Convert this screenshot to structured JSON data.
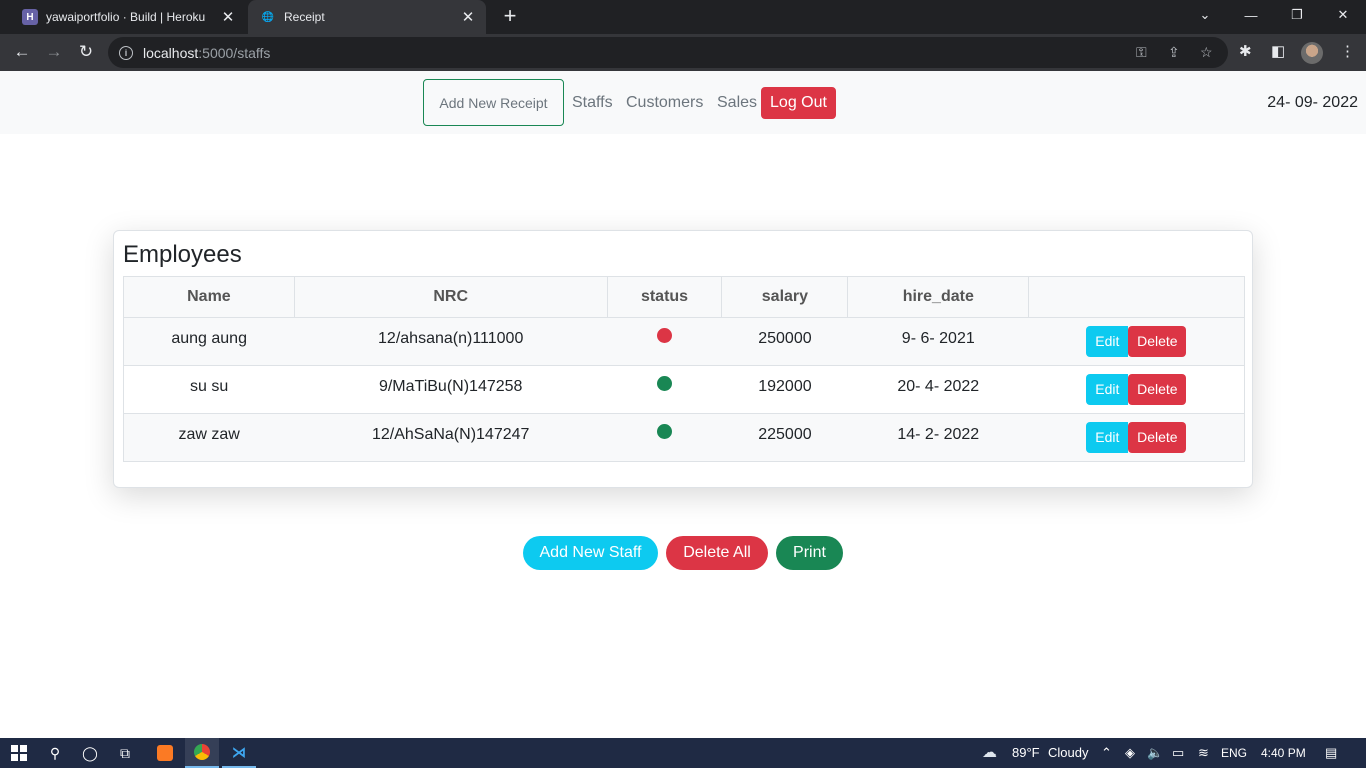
{
  "browser": {
    "tabs": [
      {
        "title": "yawaiportfolio · Build | Heroku",
        "icon": "heroku-icon"
      },
      {
        "title": "Receipt",
        "icon": "globe-icon"
      }
    ],
    "url_host": "localhost",
    "url_path": ":5000/staffs"
  },
  "nav": {
    "add_receipt": "Add New Receipt",
    "staffs": "Staffs",
    "customers": "Customers",
    "sales": "Sales",
    "logout": "Log Out",
    "date": "24- 09- 2022"
  },
  "employees": {
    "title": "Employees",
    "columns": [
      "Name",
      "NRC",
      "status",
      "salary",
      "hire_date",
      ""
    ],
    "rows": [
      {
        "name": "aung aung",
        "nrc": "12/ahsana(n)111000",
        "status_color": "#dc3545",
        "salary": "250000",
        "hire_date": "9- 6- 2021"
      },
      {
        "name": "su su",
        "nrc": "9/MaTiBu(N)147258",
        "status_color": "#198754",
        "salary": "192000",
        "hire_date": "20- 4- 2022"
      },
      {
        "name": "zaw zaw",
        "nrc": "12/AhSaNa(N)147247",
        "status_color": "#198754",
        "salary": "225000",
        "hire_date": "14- 2- 2022"
      }
    ],
    "edit_label": "Edit",
    "delete_label": "Delete"
  },
  "actions": {
    "add_staff": "Add New Staff",
    "delete_all": "Delete All",
    "print": "Print"
  },
  "colors": {
    "info": "#0dcaf0",
    "danger": "#dc3545",
    "success": "#198754"
  },
  "taskbar": {
    "temperature": "89°F",
    "weather": "Cloudy",
    "language": "ENG",
    "time": "4:40 PM"
  }
}
